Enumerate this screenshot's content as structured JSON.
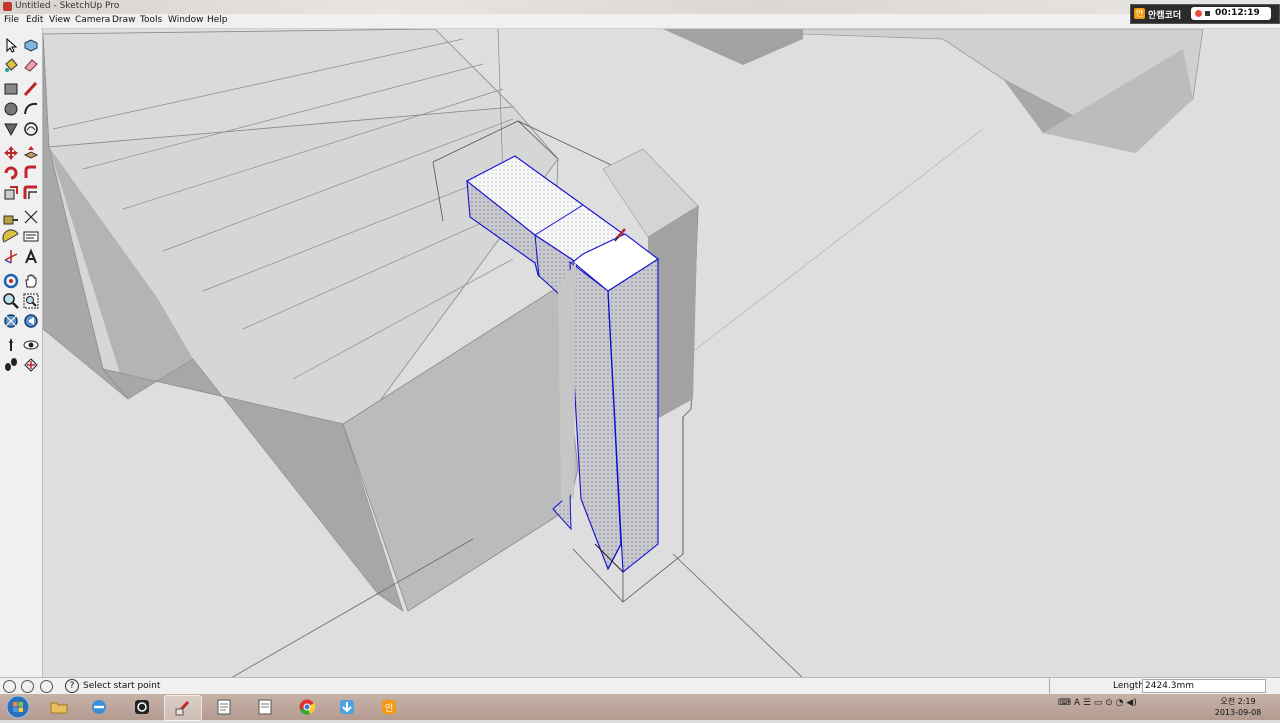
{
  "window": {
    "title": "Untitled - SketchUp Pro"
  },
  "menu": [
    "File",
    "Edit",
    "View",
    "Camera",
    "Draw",
    "Tools",
    "Window",
    "Help"
  ],
  "recorder": {
    "name": "안캠코더",
    "logo": "안",
    "time": "00:12:19"
  },
  "toolbar": {
    "tools": [
      "select-icon",
      "component-icon",
      "paint-bucket-icon",
      "eraser-icon",
      "rectangle-icon",
      "line-icon",
      "circle-icon",
      "arc-icon",
      "polygon-icon",
      "freehand-icon",
      "move-icon",
      "push-pull-icon",
      "rotate-icon",
      "follow-me-icon",
      "scale-icon",
      "offset-icon",
      "tape-measure-icon",
      "dimension-icon",
      "protractor-icon",
      "text-icon",
      "axes-icon",
      "3d-text-icon",
      "orbit-icon",
      "pan-icon",
      "zoom-icon",
      "zoom-window-icon",
      "zoom-extents-icon",
      "previous-view-icon",
      "position-camera-icon",
      "look-around-icon",
      "walk-icon",
      "section-plane-icon"
    ]
  },
  "status": {
    "hint": "Select start point",
    "help": "?",
    "measure_label": "Length",
    "measure_value": "2424.3mm"
  },
  "taskbar": {
    "apps": [
      "start-button",
      "explorer",
      "internet-explorer",
      "recorder-app",
      "sketchup",
      "document",
      "document-2",
      "chrome",
      "downloader",
      "ancam"
    ]
  },
  "tray": {
    "icons": "⌨ A ☰ ▭ ⊙ ◔ ◀)",
    "time": "오전 2:19",
    "date": "2013-09-08"
  },
  "colors": {
    "selection_blue": "#1010d0",
    "face_gray": "#bdbdbd",
    "sky": "#dedede"
  }
}
